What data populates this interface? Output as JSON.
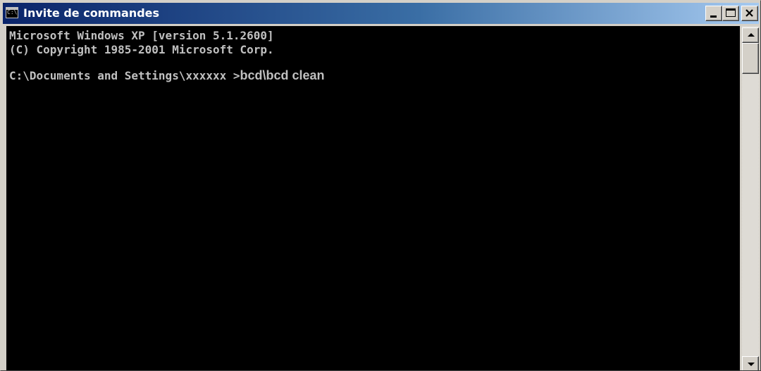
{
  "window": {
    "title": "Invite de commandes",
    "icon": "cmd-icon",
    "icon_text": "C:\\",
    "buttons": {
      "minimize": "minimize-icon",
      "maximize": "maximize-icon",
      "close": "close-icon"
    }
  },
  "console": {
    "lines": [
      "Microsoft Windows XP [version 5.1.2600]",
      "(C) Copyright 1985-2001 Microsoft Corp."
    ],
    "prompt": "C:\\Documents and Settings\\xxxxxx >",
    "command": "bcd\\bcd clean"
  },
  "colors": {
    "titlebar_start": "#0a246a",
    "titlebar_end": "#a6caf0",
    "console_background": "#000000",
    "console_text": "#c0c0c0",
    "chrome": "#d4d0c8"
  }
}
